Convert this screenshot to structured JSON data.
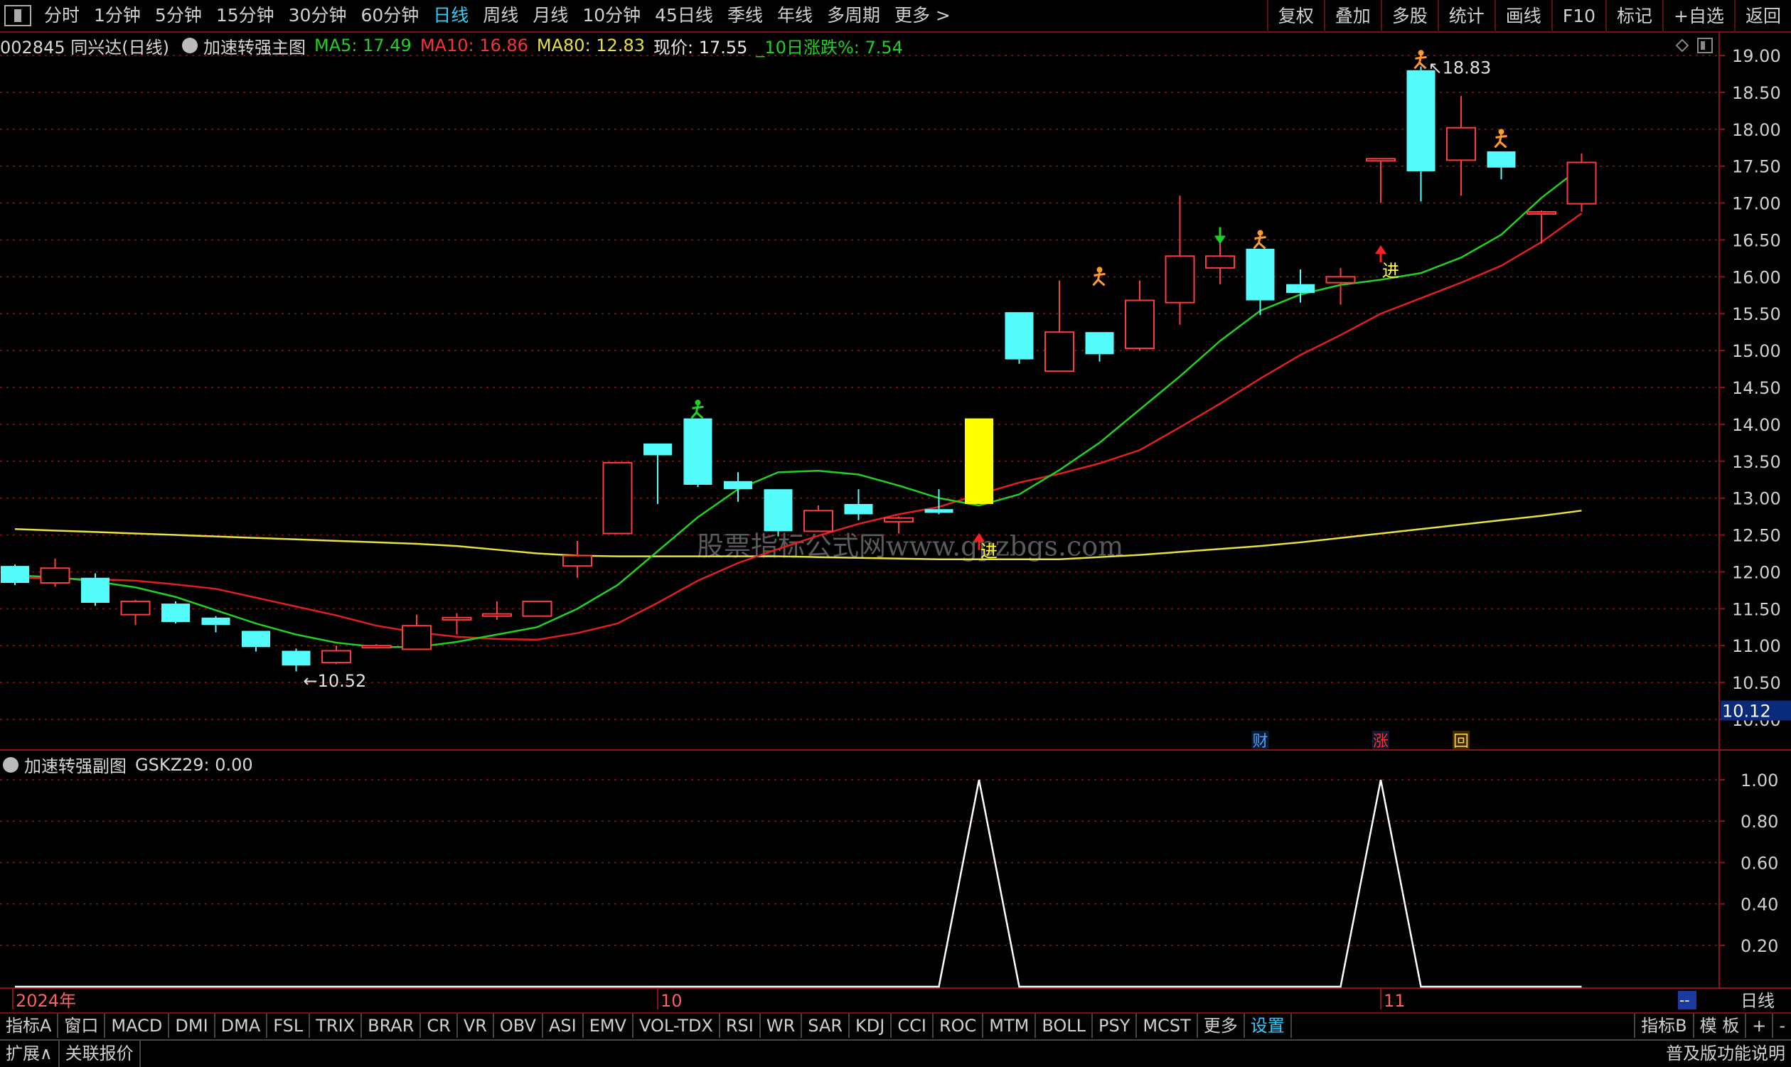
{
  "topbar": {
    "periods": [
      "分时",
      "1分钟",
      "5分钟",
      "15分钟",
      "30分钟",
      "60分钟",
      "日线",
      "周线",
      "月线",
      "10分钟",
      "45日线",
      "季线",
      "年线",
      "多周期",
      "更多 >"
    ],
    "active_period": "日线",
    "right_buttons": [
      "复权",
      "叠加",
      "多股",
      "统计",
      "画线",
      "F10",
      "标记",
      "+自选",
      "返回"
    ]
  },
  "main_info": {
    "stock": "002845 同兴达(日线)",
    "indicator": "加速转强主图",
    "ma5": "MA5: 17.49",
    "ma10": "MA10: 16.86",
    "ma80": "MA80: 12.83",
    "price": "现价: 17.55",
    "change": "_10日涨跌%: 7.54"
  },
  "sub_info": {
    "indicator": "加速转强副图",
    "value": "GSKZ29: 0.00"
  },
  "colors": {
    "up": "#ff3b3b",
    "down": "#54fcfc",
    "ma5": "#22d022",
    "ma10": "#e02020",
    "ma80": "#e8e040",
    "grid": "#8a1414",
    "axis_text": "#d0d0d0",
    "signal_yellow": "#ffff00"
  },
  "chart_data": [
    {
      "type": "candlestick",
      "panel": "main",
      "ylim": [
        10.0,
        19.0
      ],
      "yticks": [
        "19.00",
        "18.50",
        "18.00",
        "17.50",
        "17.00",
        "16.50",
        "16.00",
        "15.50",
        "15.00",
        "14.50",
        "14.00",
        "13.50",
        "13.00",
        "12.50",
        "12.00",
        "11.50",
        "11.00",
        "10.50",
        "10.00"
      ],
      "current_axis_label": "10.12",
      "candles": [
        [
          12.08,
          11.85,
          12.1,
          11.82
        ],
        [
          11.85,
          12.05,
          12.18,
          11.8
        ],
        [
          11.92,
          11.58,
          11.98,
          11.54
        ],
        [
          11.42,
          11.6,
          11.62,
          11.28
        ],
        [
          11.57,
          11.32,
          11.6,
          11.3
        ],
        [
          11.38,
          11.28,
          11.4,
          11.18
        ],
        [
          11.2,
          10.98,
          11.2,
          10.92
        ],
        [
          10.93,
          10.73,
          10.96,
          10.65
        ],
        [
          10.77,
          10.93,
          11.0,
          10.75
        ],
        [
          10.99,
          11.0,
          11.02,
          10.96
        ],
        [
          10.95,
          11.27,
          11.42,
          10.95
        ],
        [
          11.35,
          11.38,
          11.44,
          11.15
        ],
        [
          11.4,
          11.43,
          11.6,
          11.35
        ],
        [
          11.4,
          11.6,
          11.6,
          11.4
        ],
        [
          12.08,
          12.22,
          12.42,
          11.92
        ],
        [
          12.52,
          13.48,
          13.48,
          12.52
        ],
        [
          13.74,
          13.58,
          13.74,
          12.92
        ],
        [
          14.08,
          13.18,
          14.08,
          13.15
        ],
        [
          13.23,
          13.12,
          13.35,
          12.95
        ],
        [
          13.12,
          12.55,
          13.12,
          12.48
        ],
        [
          12.55,
          12.83,
          12.9,
          12.55
        ],
        [
          12.92,
          12.78,
          13.12,
          12.7
        ],
        [
          12.68,
          12.73,
          12.75,
          12.52
        ],
        [
          12.85,
          12.8,
          13.12,
          12.78
        ],
        [
          14.08,
          12.92,
          14.08,
          12.92
        ],
        [
          15.52,
          14.88,
          15.52,
          14.82
        ],
        [
          14.72,
          15.25,
          15.95,
          14.72
        ],
        [
          15.25,
          14.95,
          15.25,
          14.85
        ],
        [
          15.03,
          15.68,
          15.95,
          15.0
        ],
        [
          15.65,
          16.28,
          17.1,
          15.35
        ],
        [
          16.12,
          16.28,
          16.48,
          15.9
        ],
        [
          16.38,
          15.68,
          16.38,
          15.48
        ],
        [
          15.9,
          15.78,
          16.1,
          15.65
        ],
        [
          15.92,
          16.0,
          16.12,
          15.62
        ],
        [
          17.6,
          17.6,
          17.6,
          17.0
        ],
        [
          18.8,
          17.43,
          18.85,
          17.02
        ],
        [
          17.58,
          18.02,
          18.45,
          17.1
        ],
        [
          17.7,
          17.48,
          17.7,
          17.32
        ],
        [
          16.88,
          16.88,
          16.9,
          16.45
        ],
        [
          16.99,
          17.55,
          17.67,
          16.88
        ]
      ],
      "ma5": [
        11.95,
        11.93,
        11.87,
        11.79,
        11.66,
        11.48,
        11.3,
        11.15,
        11.04,
        10.98,
        10.98,
        11.05,
        11.15,
        11.25,
        11.5,
        11.82,
        12.28,
        12.74,
        13.12,
        13.35,
        13.37,
        13.32,
        13.17,
        13.0,
        12.9,
        13.05,
        13.38,
        13.75,
        14.2,
        14.65,
        15.13,
        15.54,
        15.76,
        15.89,
        15.96,
        16.05,
        16.26,
        16.57,
        17.07,
        17.49
      ],
      "ma10": [
        11.92,
        11.91,
        11.9,
        11.88,
        11.83,
        11.77,
        11.65,
        11.53,
        11.41,
        11.27,
        11.18,
        11.12,
        11.09,
        11.08,
        11.17,
        11.3,
        11.58,
        11.88,
        12.12,
        12.31,
        12.49,
        12.65,
        12.78,
        12.88,
        13.05,
        13.21,
        13.33,
        13.47,
        13.65,
        13.96,
        14.28,
        14.62,
        14.94,
        15.21,
        15.5,
        15.71,
        15.92,
        16.15,
        16.47,
        16.86
      ],
      "ma80": [
        12.58,
        12.56,
        12.54,
        12.52,
        12.5,
        12.48,
        12.46,
        12.44,
        12.42,
        12.4,
        12.38,
        12.35,
        12.3,
        12.25,
        12.22,
        12.21,
        12.21,
        12.21,
        12.21,
        12.21,
        12.2,
        12.19,
        12.18,
        12.17,
        12.17,
        12.17,
        12.17,
        12.2,
        12.23,
        12.27,
        12.31,
        12.35,
        12.4,
        12.46,
        12.52,
        12.58,
        12.64,
        12.7,
        12.76,
        12.83
      ],
      "annotations": [
        {
          "text": "←10.52",
          "index": 7,
          "value": 10.52
        },
        {
          "text": "↖18.83",
          "index": 35,
          "value": 18.83
        },
        {
          "text": "进",
          "index": 24,
          "value": 12.3
        },
        {
          "text": "进",
          "index": 34,
          "value": 16.1
        }
      ],
      "highlighted_candle_index": 24,
      "event_markers": [
        "财",
        "涨",
        "回"
      ]
    },
    {
      "type": "line",
      "panel": "sub",
      "ylim": [
        0.0,
        1.0
      ],
      "yticks": [
        "1.00",
        "0.80",
        "0.60",
        "0.40",
        "0.20"
      ],
      "values": [
        0,
        0,
        0,
        0,
        0,
        0,
        0,
        0,
        0,
        0,
        0,
        0,
        0,
        0,
        0,
        0,
        0,
        0,
        0,
        0,
        0,
        0,
        0,
        0,
        1,
        0,
        0,
        0,
        0,
        0,
        0,
        0,
        0,
        0,
        1,
        0,
        0,
        0,
        0,
        0
      ]
    }
  ],
  "time_axis": {
    "labels": [
      "2024年",
      "10",
      "11"
    ],
    "label_indices": [
      0,
      16,
      34
    ]
  },
  "watermark": "股票指标公式网www.gpzbgs.com",
  "sub_corner_label": "--",
  "period_label": "日线",
  "tabs": [
    "指标A",
    "窗口",
    "MACD",
    "DMI",
    "DMA",
    "FSL",
    "TRIX",
    "BRAR",
    "CR",
    "VR",
    "OBV",
    "ASI",
    "EMV",
    "VOL-TDX",
    "RSI",
    "WR",
    "SAR",
    "KDJ",
    "CCI",
    "ROC",
    "MTM",
    "BOLL",
    "PSY",
    "MCST",
    "更多",
    "设置"
  ],
  "tabs_right": [
    "指标B",
    "模 板",
    "+",
    "-"
  ],
  "status": {
    "expand": "扩展∧",
    "related": "关联报价",
    "right": "普及版功能说明"
  }
}
